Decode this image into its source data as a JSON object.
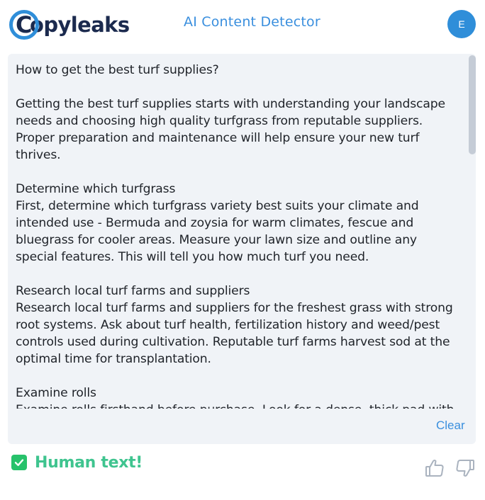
{
  "header": {
    "logo_text": "Copyleaks",
    "logo_mark": "C",
    "app_title": "AI Content Detector",
    "avatar_initial": "E"
  },
  "document": {
    "paragraphs": [
      "How to get the best turf supplies?",
      "Getting the best turf supplies starts with understanding your landscape needs and choosing high quality turfgrass from reputable suppliers. Proper preparation and maintenance will help ensure your new turf thrives.",
      "Determine which turfgrass\nFirst, determine which turfgrass variety best suits your climate and intended use - Bermuda and zoysia for warm climates, fescue and bluegrass for cooler areas. Measure your lawn size and outline any special features. This will tell you how much turf you need.",
      "Research local turf farms and suppliers\nResearch local turf farms and suppliers for the freshest grass with strong root systems. Ask about turf health, fertilization history and weed/pest controls used during cultivation. Reputable turf farms harvest sod at the optimal time for transplantation.",
      "Examine rolls\nExamine rolls firsthand before purchase. Look for a dense, thick pad with no bare spots or weeds. Grass should have a consistent green color and stand"
    ],
    "clear_label": "Clear"
  },
  "result": {
    "label": "Human text!",
    "status_color": "#3fc48f",
    "check_icon": "check-icon"
  },
  "feedback": {
    "up_icon": "thumbs-up-icon",
    "down_icon": "thumbs-down-icon"
  },
  "colors": {
    "accent": "#3a8fde",
    "brand_dark": "#1b2a4e",
    "panel_bg": "#f0f3f7",
    "success": "#27c26b"
  }
}
